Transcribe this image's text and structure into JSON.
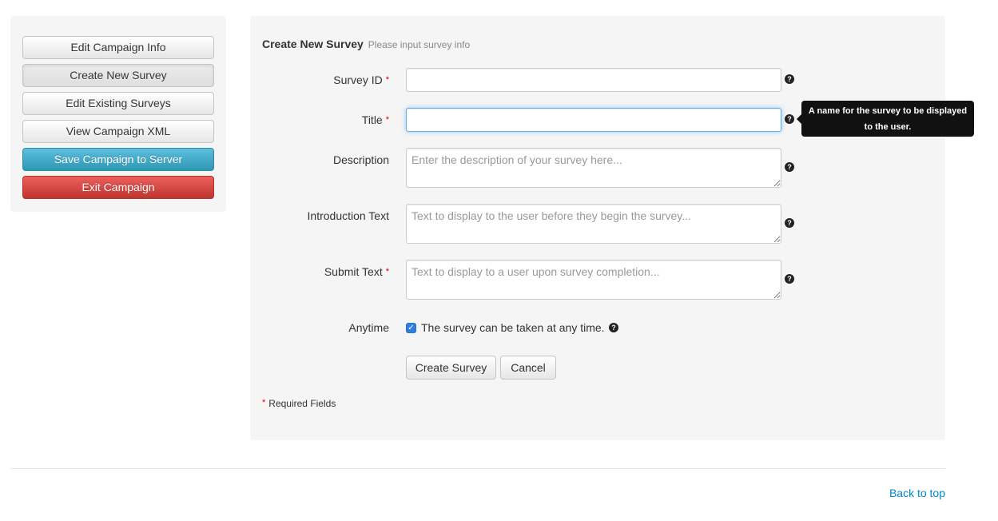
{
  "sidebar": {
    "buttons": [
      {
        "label": "Edit Campaign Info"
      },
      {
        "label": "Create New Survey"
      },
      {
        "label": "Edit Existing Surveys"
      },
      {
        "label": "View Campaign XML"
      },
      {
        "label": "Save Campaign to Server"
      },
      {
        "label": "Exit Campaign"
      }
    ]
  },
  "form": {
    "legend_title": "Create New Survey",
    "legend_subtitle": "Please input survey info",
    "required_marker": "*",
    "fields": {
      "survey_id": {
        "label": "Survey ID",
        "value": "",
        "placeholder": ""
      },
      "title": {
        "label": "Title",
        "value": "",
        "placeholder": ""
      },
      "description": {
        "label": "Description",
        "placeholder": "Enter the description of your survey here..."
      },
      "intro_text": {
        "label": "Introduction Text",
        "placeholder": "Text to display to the user before they begin the survey..."
      },
      "submit_text": {
        "label": "Submit Text",
        "placeholder": "Text to display to a user upon survey completion..."
      },
      "anytime": {
        "label": "Anytime",
        "checkbox_label": "The survey can be taken at any time.",
        "checked": true
      }
    },
    "help_glyph": "?",
    "tooltip_text": "A name for the survey to be displayed to the user.",
    "create_button": "Create Survey",
    "cancel_button": "Cancel",
    "required_note": "Required Fields"
  },
  "footer": {
    "back_to_top": "Back to top"
  },
  "colors": {
    "info_button": "#49afcd",
    "danger_button": "#da4f49",
    "link": "#0088cc",
    "required": "#dd0000"
  },
  "icons": {
    "help": "question-circle-icon",
    "checkbox": "checkmark-icon"
  }
}
